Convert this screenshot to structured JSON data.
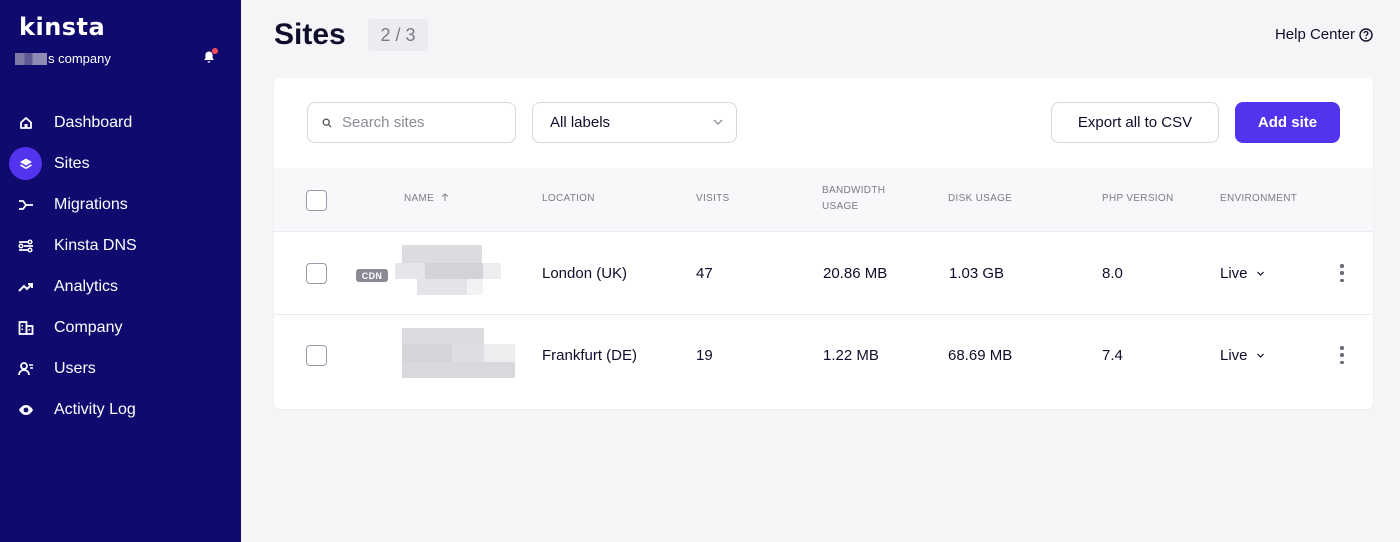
{
  "sidebar": {
    "logo": "kinsta",
    "company_suffix": "s company",
    "items": [
      {
        "label": "Dashboard",
        "icon": "home-icon"
      },
      {
        "label": "Sites",
        "icon": "layers-icon",
        "active": true
      },
      {
        "label": "Migrations",
        "icon": "migrate-icon"
      },
      {
        "label": "Kinsta DNS",
        "icon": "dns-icon"
      },
      {
        "label": "Analytics",
        "icon": "trend-icon"
      },
      {
        "label": "Company",
        "icon": "building-icon"
      },
      {
        "label": "Users",
        "icon": "users-icon"
      },
      {
        "label": "Activity Log",
        "icon": "eye-icon"
      }
    ],
    "bell_has_notification": true
  },
  "header": {
    "title": "Sites",
    "count": "2 / 3",
    "help": "Help Center"
  },
  "toolbar": {
    "search_placeholder": "Search sites",
    "labels_filter": "All labels",
    "export_label": "Export all to CSV",
    "add_label": "Add site"
  },
  "table": {
    "headers": {
      "name": "NAME",
      "location": "LOCATION",
      "visits": "VISITS",
      "bandwidth_1": "BANDWIDTH",
      "bandwidth_2": "USAGE",
      "disk": "DISK USAGE",
      "php": "PHP VERSION",
      "environment": "ENVIRONMENT"
    },
    "rows": [
      {
        "cdn": "CDN",
        "location": "London (UK)",
        "visits": "47",
        "bandwidth": "20.86 MB",
        "disk": "1.03 GB",
        "php": "8.0",
        "environment": "Live"
      },
      {
        "cdn": "",
        "location": "Frankfurt (DE)",
        "visits": "19",
        "bandwidth": "1.22 MB",
        "disk": "68.69 MB",
        "php": "7.4",
        "environment": "Live"
      }
    ]
  },
  "colors": {
    "sidebar_bg": "#0f0a6e",
    "accent": "#5333ed",
    "notification": "#ff4d5a"
  }
}
